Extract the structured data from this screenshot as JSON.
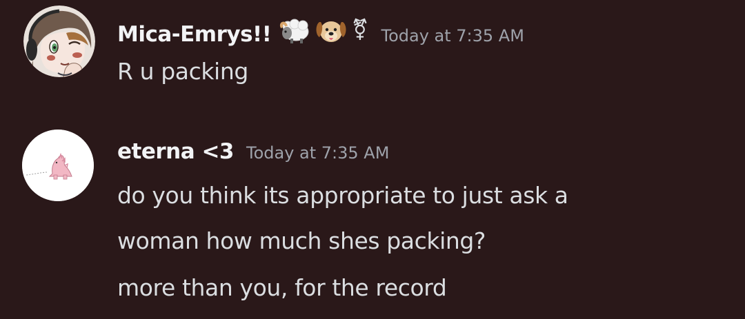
{
  "messages": [
    {
      "author": "Mica-Emrys!!",
      "badges": [
        "sheep-emoji",
        "dog-face-emoji",
        "transgender-symbol"
      ],
      "transgender_symbol": "⚧",
      "timestamp": "Today at 7:35 AM",
      "lines": [
        "R u packing"
      ]
    },
    {
      "author": "eterna <3",
      "timestamp": "Today at 7:35 AM",
      "lines": [
        "do you think its appropriate to just ask a",
        "woman how much shes packing?",
        "more than you, for the record"
      ]
    }
  ],
  "colors": {
    "background": "#2a1819",
    "username": "#f2f3f5",
    "timestamp": "#9ea2aa",
    "message_text": "#dbdee1"
  }
}
